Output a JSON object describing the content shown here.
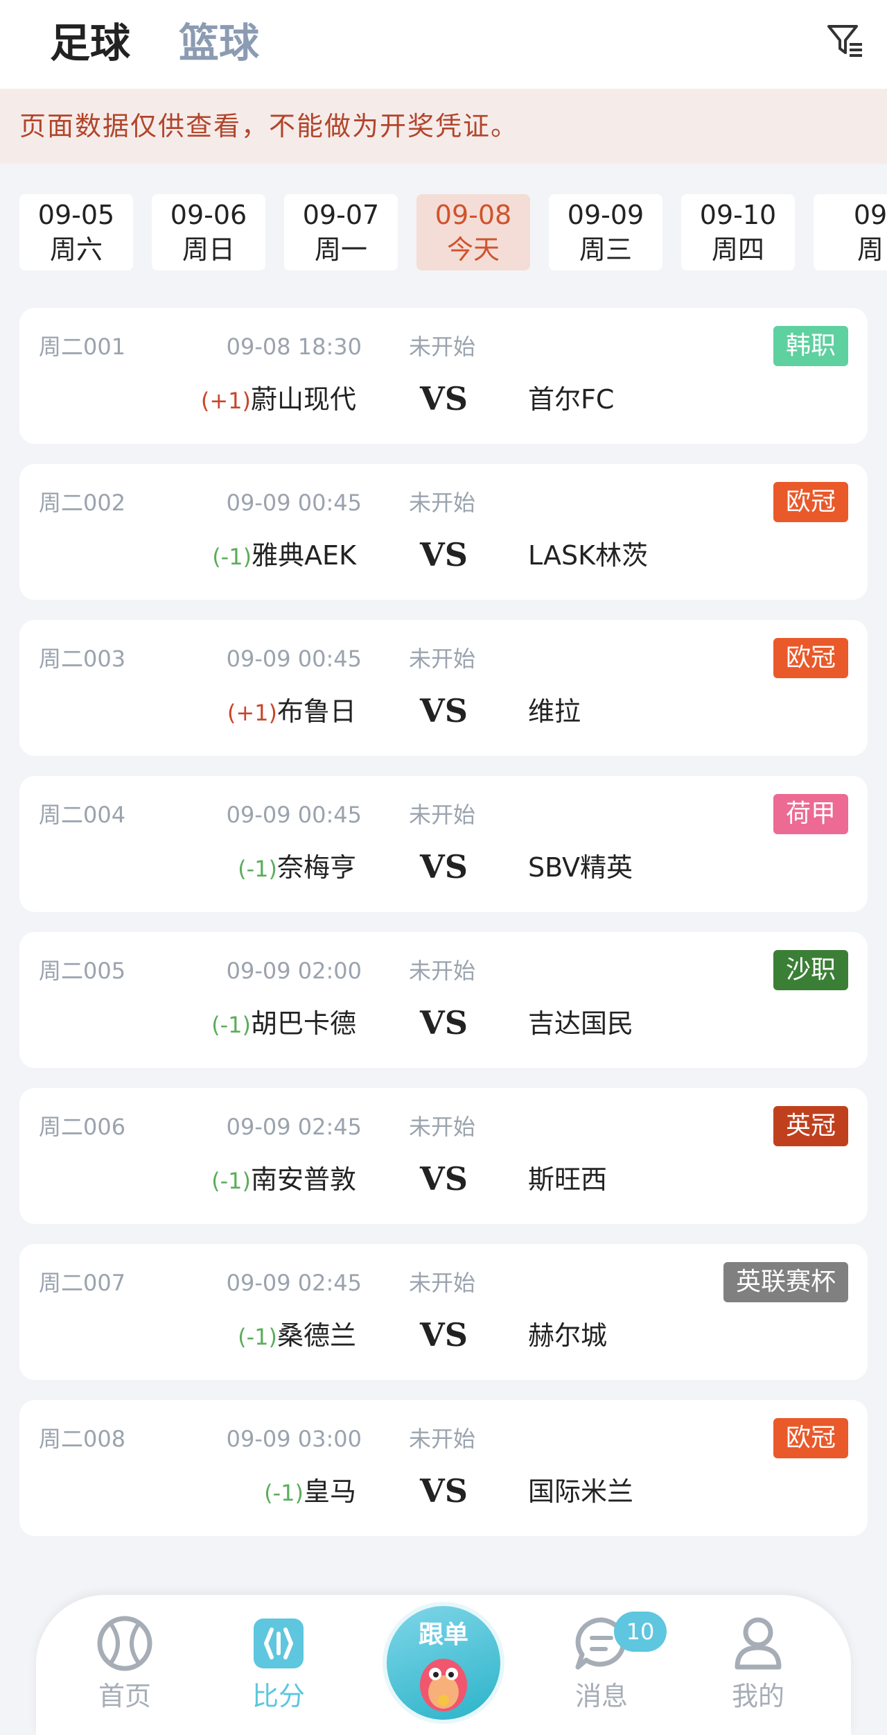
{
  "header": {
    "tabs": [
      {
        "label": "足球",
        "active": true
      },
      {
        "label": "篮球",
        "active": false
      }
    ],
    "filter_icon": "filter-icon"
  },
  "notice": "页面数据仅供查看，不能做为开奖凭证。",
  "dates": [
    {
      "date": "09-05",
      "weekday": "周六",
      "active": false
    },
    {
      "date": "09-06",
      "weekday": "周日",
      "active": false
    },
    {
      "date": "09-07",
      "weekday": "周一",
      "active": false
    },
    {
      "date": "09-08",
      "weekday": "今天",
      "active": true
    },
    {
      "date": "09-09",
      "weekday": "周三",
      "active": false
    },
    {
      "date": "09-10",
      "weekday": "周四",
      "active": false
    },
    {
      "date": "09",
      "weekday": "周",
      "active": false
    }
  ],
  "vs_label": "VS",
  "matches": [
    {
      "code": "周二001",
      "time": "09-08 18:30",
      "status": "未开始",
      "league": "韩职",
      "league_color": "#5fd0a0",
      "handicap": "(+1)",
      "handicap_color": "#c8452a",
      "home": "蔚山现代",
      "away": "首尔FC"
    },
    {
      "code": "周二002",
      "time": "09-09 00:45",
      "status": "未开始",
      "league": "欧冠",
      "league_color": "#e9592a",
      "handicap": "(-1)",
      "handicap_color": "#5aad5a",
      "home": "雅典AEK",
      "away": "LASK林茨"
    },
    {
      "code": "周二003",
      "time": "09-09 00:45",
      "status": "未开始",
      "league": "欧冠",
      "league_color": "#e9592a",
      "handicap": "(+1)",
      "handicap_color": "#c8452a",
      "home": "布鲁日",
      "away": "维拉"
    },
    {
      "code": "周二004",
      "time": "09-09 00:45",
      "status": "未开始",
      "league": "荷甲",
      "league_color": "#ec6a93",
      "handicap": "(-1)",
      "handicap_color": "#5aad5a",
      "home": "奈梅亨",
      "away": "SBV精英"
    },
    {
      "code": "周二005",
      "time": "09-09 02:00",
      "status": "未开始",
      "league": "沙职",
      "league_color": "#3b7f36",
      "handicap": "(-1)",
      "handicap_color": "#5aad5a",
      "home": "胡巴卡德",
      "away": "吉达国民"
    },
    {
      "code": "周二006",
      "time": "09-09 02:45",
      "status": "未开始",
      "league": "英冠",
      "league_color": "#c0401e",
      "handicap": "(-1)",
      "handicap_color": "#5aad5a",
      "home": "南安普敦",
      "away": "斯旺西"
    },
    {
      "code": "周二007",
      "time": "09-09 02:45",
      "status": "未开始",
      "league": "英联赛杯",
      "league_color": "#808080",
      "handicap": "(-1)",
      "handicap_color": "#5aad5a",
      "home": "桑德兰",
      "away": "赫尔城"
    },
    {
      "code": "周二008",
      "time": "09-09 03:00",
      "status": "未开始",
      "league": "欧冠",
      "league_color": "#e9592a",
      "handicap": "(-1)",
      "handicap_color": "#5aad5a",
      "home": "皇马",
      "away": "国际米兰"
    }
  ],
  "bottom_nav": {
    "items": [
      {
        "label": "首页",
        "icon": "ball-icon",
        "active": false
      },
      {
        "label": "比分",
        "icon": "score-icon",
        "active": true
      },
      {
        "label": "消息",
        "icon": "message-icon",
        "active": false,
        "badge": "10"
      },
      {
        "label": "我的",
        "icon": "profile-icon",
        "active": false
      }
    ],
    "center": {
      "label": "跟单",
      "icon": "mascot-icon"
    }
  },
  "colors": {
    "accent": "#5ec6de",
    "active_date_bg": "#f4ddd7",
    "active_date_text": "#d0532c",
    "notice_text": "#b2452b",
    "inactive_tab": "#8b9bb2",
    "muted": "#9aa3ae"
  }
}
